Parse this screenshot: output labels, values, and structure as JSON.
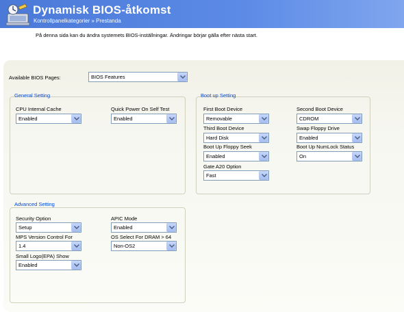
{
  "header": {
    "title": "Dynamisk BIOS-åtkomst",
    "subtitle": "Kontrollpanelkategorier » Prestanda",
    "icon": "computer-settings-icon"
  },
  "intro": "På denna sida kan du ändra systemets BIOS-inställningar.  Ändringar börjar gälla efter nästa start.",
  "bios_pages": {
    "label": "Available BIOS Pages:",
    "value": "BIOS Features"
  },
  "general": {
    "title": "General Setting",
    "cpu_cache": {
      "label": "CPU Internal Cache",
      "value": "Enabled"
    },
    "quick_post": {
      "label": "Quick Power On Self Test",
      "value": "Enabled"
    }
  },
  "boot": {
    "title": "Boot up Setting",
    "first": {
      "label": "First Boot Device",
      "value": "Removable"
    },
    "second": {
      "label": "Second Boot Device",
      "value": "CDROM"
    },
    "third": {
      "label": "Third Boot Device",
      "value": "Hard Disk"
    },
    "swap_floppy": {
      "label": "Swap Floppy Drive",
      "value": "Enabled"
    },
    "floppy_seek": {
      "label": "Boot Up Floppy Seek",
      "value": "Enabled"
    },
    "numlock": {
      "label": "Boot Up NumLock Status",
      "value": "On"
    },
    "gate_a20": {
      "label": "Gate A20 Option",
      "value": "Fast"
    }
  },
  "advanced": {
    "title": "Advanced Setting",
    "security": {
      "label": "Security Option",
      "value": "Setup"
    },
    "apic": {
      "label": "APIC Mode",
      "value": "Enabled"
    },
    "mps": {
      "label": "MPS Version Control For",
      "value": "1.4"
    },
    "os_dram": {
      "label": "OS Select For DRAM > 64",
      "value": "Non-OS2"
    },
    "small_logo": {
      "label": "Small Logo(EPA) Show",
      "value": "Enabled"
    }
  }
}
